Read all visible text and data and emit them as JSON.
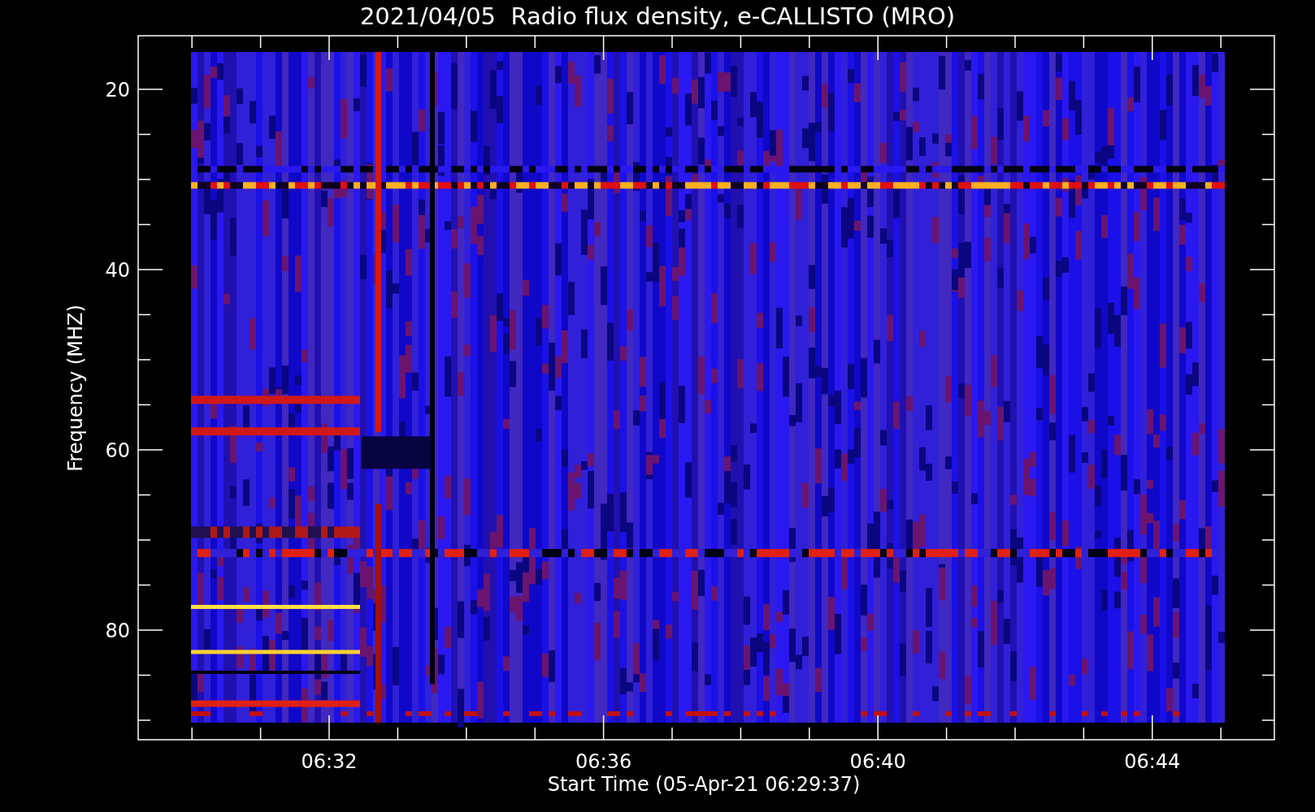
{
  "title": "2021/04/05  Radio flux density, e-CALLISTO (MRO)",
  "y_axis": {
    "label": "Frequency (MHZ)",
    "ticks": [
      "20",
      "40",
      "60",
      "80"
    ]
  },
  "x_axis": {
    "label": "Start Time (05-Apr-21 06:29:37)",
    "ticks": [
      "06:32",
      "06:36",
      "06:40",
      "06:44"
    ]
  }
}
